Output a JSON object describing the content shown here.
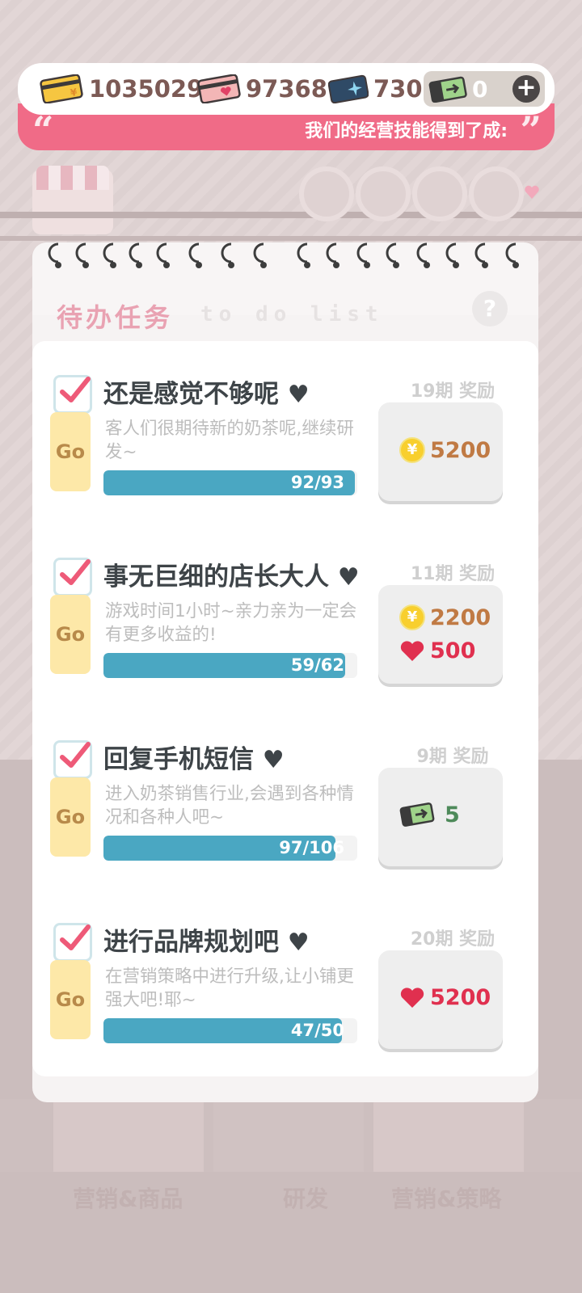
{
  "currencies": {
    "gold_card": {
      "value": "1035029",
      "icon": "gold-card-icon"
    },
    "pink_card": {
      "value": "97368",
      "icon": "pink-card-icon"
    },
    "blue_card": {
      "value": "730",
      "icon": "blue-card-icon"
    },
    "ticket": {
      "value": "0",
      "icon": "ticket-icon"
    }
  },
  "marquee": {
    "text": "我们的经营技能得到了成:"
  },
  "panel": {
    "title": "待办任务",
    "subtitle": "to do list",
    "help": "?"
  },
  "tasks": [
    {
      "title": "还是感觉不够呢",
      "heart": "♥",
      "desc": "客人们很期待新的奶茶呢,继续研发~",
      "go": "Go",
      "progress_text": "92/93",
      "progress": 0.989,
      "period": "19期 奖励",
      "rewards": [
        {
          "icon": "coin-icon",
          "value": "5200",
          "color": "#c07a44"
        }
      ]
    },
    {
      "title": "事无巨细的店长大人",
      "heart": "♥",
      "desc": "游戏时间1小时~亲力亲为一定会有更多收益的!",
      "go": "Go",
      "progress_text": "59/62",
      "progress": 0.952,
      "period": "11期 奖励",
      "rewards": [
        {
          "icon": "coin-icon",
          "value": "2200",
          "color": "#c07a44"
        },
        {
          "icon": "heart-icon",
          "value": "500",
          "color": "#e0304f"
        }
      ]
    },
    {
      "title": "回复手机短信",
      "heart": "♥",
      "desc": "进入奶茶销售行业,会遇到各种情况和各种人吧~",
      "go": "Go",
      "progress_text": "97/106",
      "progress": 0.915,
      "period": "9期 奖励",
      "rewards": [
        {
          "icon": "ticket-icon",
          "value": "5",
          "color": "#4e8a5a"
        }
      ]
    },
    {
      "title": "进行品牌规划吧",
      "heart": "♥",
      "desc": "在营销策略中进行升级,让小铺更强大吧!耶~",
      "go": "Go",
      "progress_text": "47/50",
      "progress": 0.94,
      "period": "20期 奖励",
      "rewards": [
        {
          "icon": "heart-icon",
          "value": "5200",
          "color": "#e0304f"
        }
      ]
    }
  ],
  "background": {
    "tab_left": "营销&商品",
    "tab_mid": "研发",
    "tab_right": "营销&策略"
  }
}
